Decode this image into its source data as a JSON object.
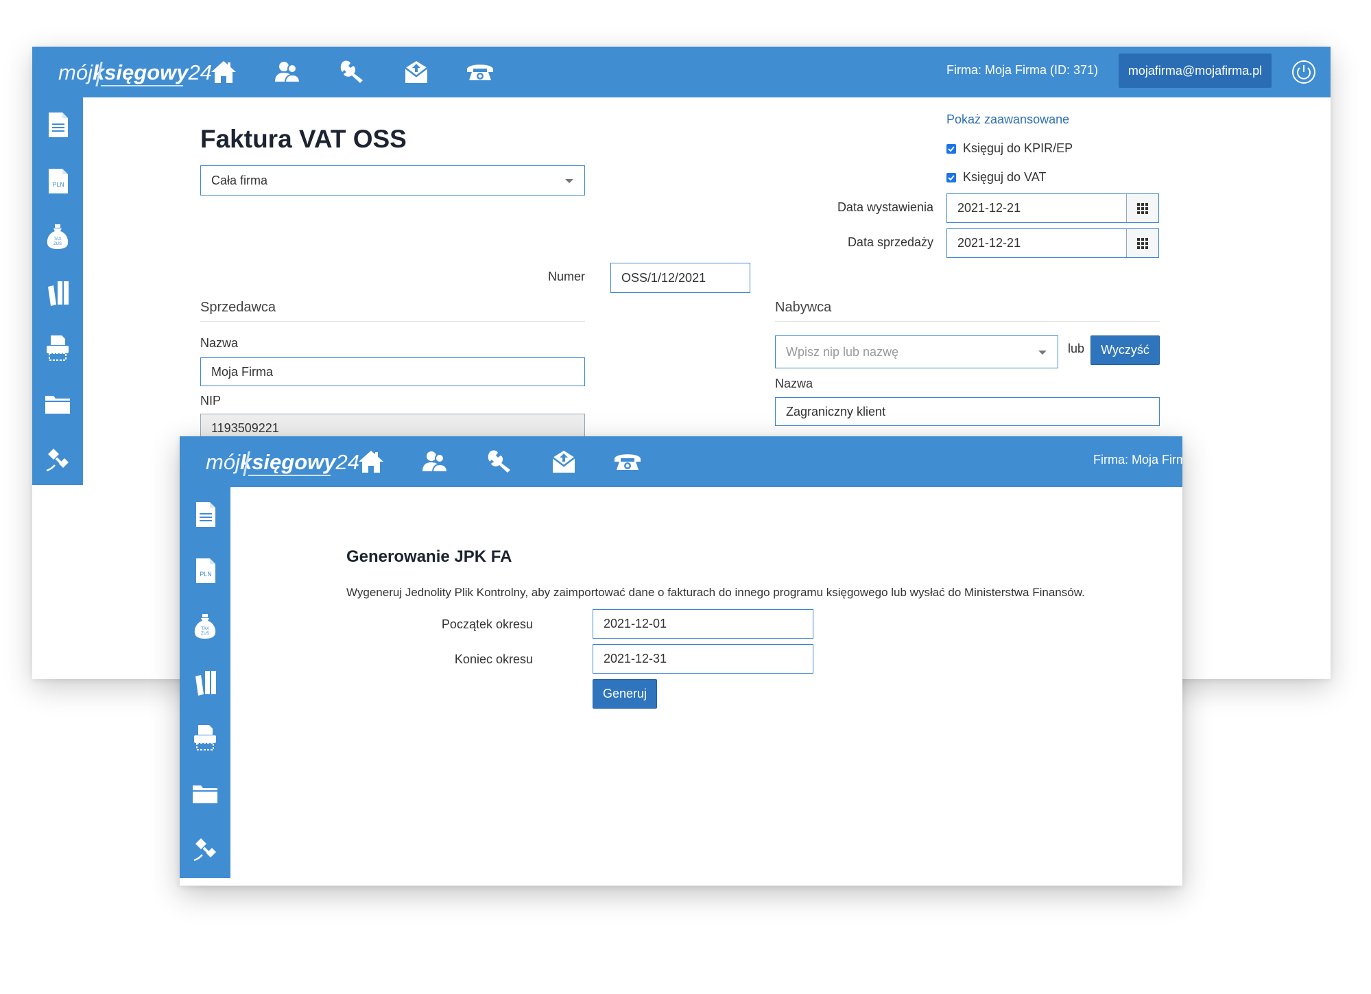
{
  "app": {
    "logo": {
      "part1": "mój",
      "part2": "księgowy",
      "part3": "24"
    },
    "nav_icons": [
      "home-icon",
      "users-icon",
      "wrench-icon",
      "mail-icon",
      "phone-icon"
    ],
    "sidebar_icons": [
      "document-icon",
      "pln-document-icon",
      "tax-bag-icon",
      "books-icon",
      "printer-icon",
      "folder-icon",
      "satellite-icon"
    ],
    "sidebar_icon_texts": {
      "pln": "PLN",
      "tax": "TAX",
      "zus": "ZUS"
    },
    "colors": {
      "bar": "#408dd2",
      "button": "#2f75bd",
      "email_button": "#2a6db5"
    }
  },
  "invoice_window": {
    "firm_label": "Firma: Moja Firma (ID: 371)",
    "email": "mojafirma@mojafirma.pl",
    "title": "Faktura VAT OSS",
    "company_select": "Cała firma",
    "show_advanced": "Pokaż zaawansowane",
    "check_kpir": "Księguj do KPIR/EP",
    "check_vat": "Księguj do VAT",
    "issue_date_label": "Data wystawienia",
    "issue_date": "2021-12-21",
    "sale_date_label": "Data sprzedaży",
    "sale_date": "2021-12-21",
    "number_label": "Numer",
    "number": "OSS/1/12/2021",
    "seller": {
      "heading": "Sprzedawca",
      "name_label": "Nazwa",
      "name": "Moja Firma",
      "nip_label": "NIP",
      "nip": "1193509221"
    },
    "buyer": {
      "heading": "Nabywca",
      "search_placeholder": "Wpisz nip lub nazwę",
      "or_label": "lub",
      "clear_button": "Wyczyść",
      "name_label": "Nazwa",
      "name": "Zagraniczny klient"
    }
  },
  "jpk_window": {
    "firm_label": "Firma: Moja Firm",
    "title": "Generowanie JPK FA",
    "description": "Wygeneruj Jednolity Plik Kontrolny, aby zaimportować dane o fakturach do innego programu księgowego lub wysłać do Ministerstwa Finansów.",
    "start_label": "Początek okresu",
    "start_date": "2021-12-01",
    "end_label": "Koniec okresu",
    "end_date": "2021-12-31",
    "generate_button": "Generuj"
  }
}
